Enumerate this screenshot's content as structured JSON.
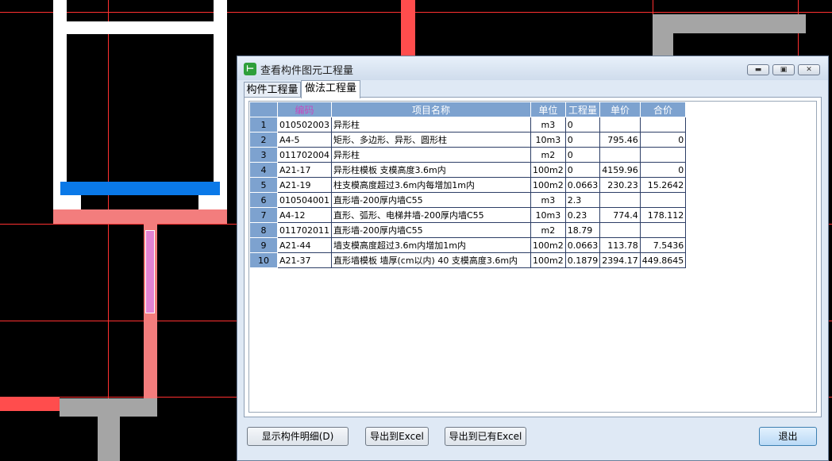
{
  "window": {
    "title": "查看构件图元工程量",
    "controls": [
      "minimize-icon",
      "restore-icon",
      "close-icon"
    ]
  },
  "tabs": [
    {
      "label": "构件工程量",
      "active": false
    },
    {
      "label": "做法工程量",
      "active": true
    }
  ],
  "table": {
    "headers": [
      "",
      "编码",
      "项目名称",
      "单位",
      "工程量",
      "单价",
      "合价"
    ],
    "rows": [
      [
        "1",
        "010502003",
        "异形柱",
        "m3",
        "0",
        "",
        ""
      ],
      [
        "2",
        "A4-5",
        "矩形、多边形、异形、圆形柱",
        "10m3",
        "0",
        "795.46",
        "0"
      ],
      [
        "3",
        "011702004",
        "异形柱",
        "m2",
        "0",
        "",
        ""
      ],
      [
        "4",
        "A21-17",
        "异形柱模板 支模高度3.6m内",
        "100m2",
        "0",
        "4159.96",
        "0"
      ],
      [
        "5",
        "A21-19",
        "柱支模高度超过3.6m内每增加1m内",
        "100m2",
        "0.0663",
        "230.23",
        "15.2642"
      ],
      [
        "6",
        "010504001",
        "直形墙-200厚内墙C55",
        "m3",
        "2.3",
        "",
        ""
      ],
      [
        "7",
        "A4-12",
        "直形、弧形、电梯井墙-200厚内墙C55",
        "10m3",
        "0.23",
        "774.4",
        "178.112"
      ],
      [
        "8",
        "011702011",
        "直形墙-200厚内墙C55",
        "m2",
        "18.79",
        "",
        ""
      ],
      [
        "9",
        "A21-44",
        "墙支模高度超过3.6m内增加1m内",
        "100m2",
        "0.0663",
        "113.78",
        "7.5436"
      ],
      [
        "10",
        "A21-37",
        "直形墙模板 墙厚(cm以内) 40 支模高度3.6m内",
        "100m2",
        "0.1879",
        "2394.17",
        "449.8645"
      ]
    ]
  },
  "buttons": {
    "show_detail": "显示构件明细(D)",
    "export_excel": "导出到Excel",
    "export_existing": "导出到已有Excel",
    "exit": "退出"
  },
  "colors": {
    "header_bg": "#7da2cf",
    "code_header_text": "#c34bc0",
    "cad_red": "#ff4d4d",
    "cad_blue": "#0a79e8",
    "cad_gray": "#a5a5a5",
    "cad_pink": "#f37d7d"
  }
}
